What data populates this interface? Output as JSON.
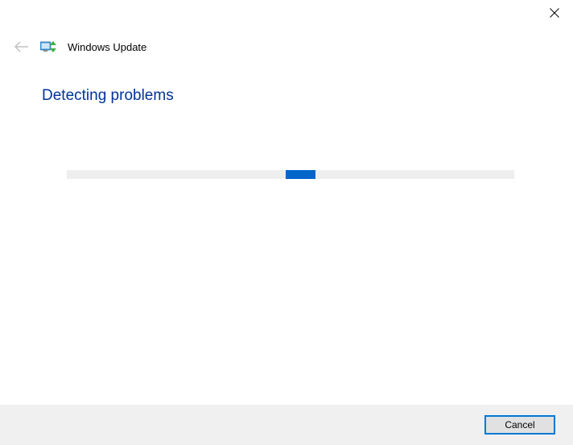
{
  "titlebar": {
    "close_label": "Close"
  },
  "header": {
    "title": "Windows Update"
  },
  "main": {
    "heading": "Detecting problems"
  },
  "footer": {
    "cancel_label": "Cancel"
  },
  "colors": {
    "accent": "#0078d7",
    "heading": "#003399",
    "progress_fill": "#0066cc",
    "footer_bg": "#f0f0f0"
  }
}
